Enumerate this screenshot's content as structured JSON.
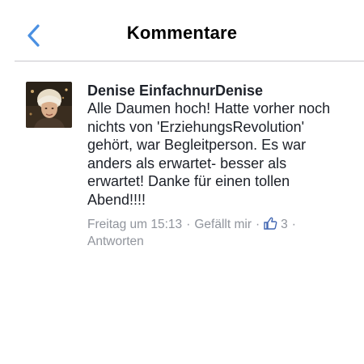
{
  "header": {
    "title": "Kommentare"
  },
  "comment": {
    "author": "Denise EinfachnurDenise",
    "text": "Alle Daumen hoch! Hatte vorher noch\nnichts von 'ErziehungsRevolution'\ngehört, war Begleitperson. Es war\nanders als erwartet- besser als\nerwartet! Danke für einen tollen\nAbend!!!!",
    "timestamp": "Freitag um 15:13",
    "like_label": "Gefällt mir",
    "like_count": "3",
    "reply_label": "Antworten",
    "separator": "·"
  },
  "colors": {
    "accent": "#4a90e2",
    "meta_text": "#90949c",
    "like_icon": "#4267b2"
  }
}
